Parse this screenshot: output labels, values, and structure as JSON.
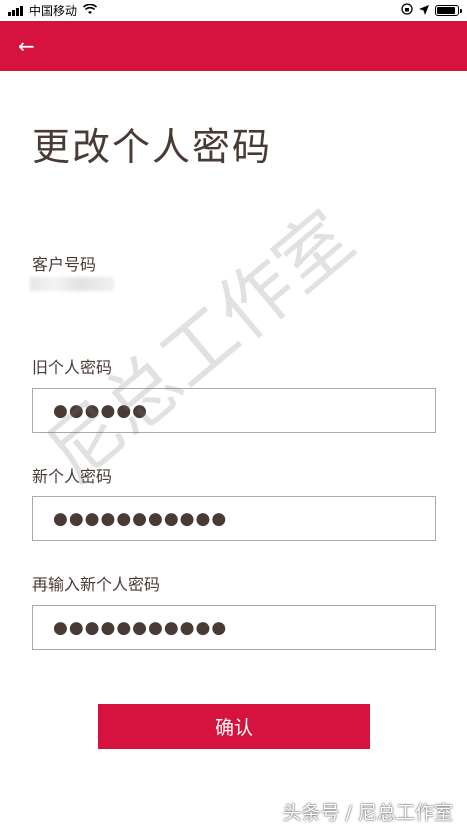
{
  "status_bar": {
    "carrier": "中国移动",
    "wifi_icon": "wifi-icon",
    "location_icon": "location-arrow-icon",
    "lock_icon": "rotation-lock-icon",
    "battery_level": 0.9
  },
  "app_bar": {
    "background": "#d6123f",
    "back_icon": "arrow-left-icon",
    "back_glyph": "←"
  },
  "page": {
    "title": "更改个人密码"
  },
  "form": {
    "customer_label": "客户号码",
    "old_password_label": "旧个人密码",
    "old_password_value": "●●●●●●",
    "new_password_label": "新个人密码",
    "new_password_value": "●●●●●●●●●●●",
    "confirm_password_label": "再输入新个人密码",
    "confirm_password_value": "●●●●●●●●●●●",
    "confirm_button_label": "确认"
  },
  "watermark": {
    "text": "尼总工作室",
    "source": "头条号 / 尼总工作室"
  }
}
